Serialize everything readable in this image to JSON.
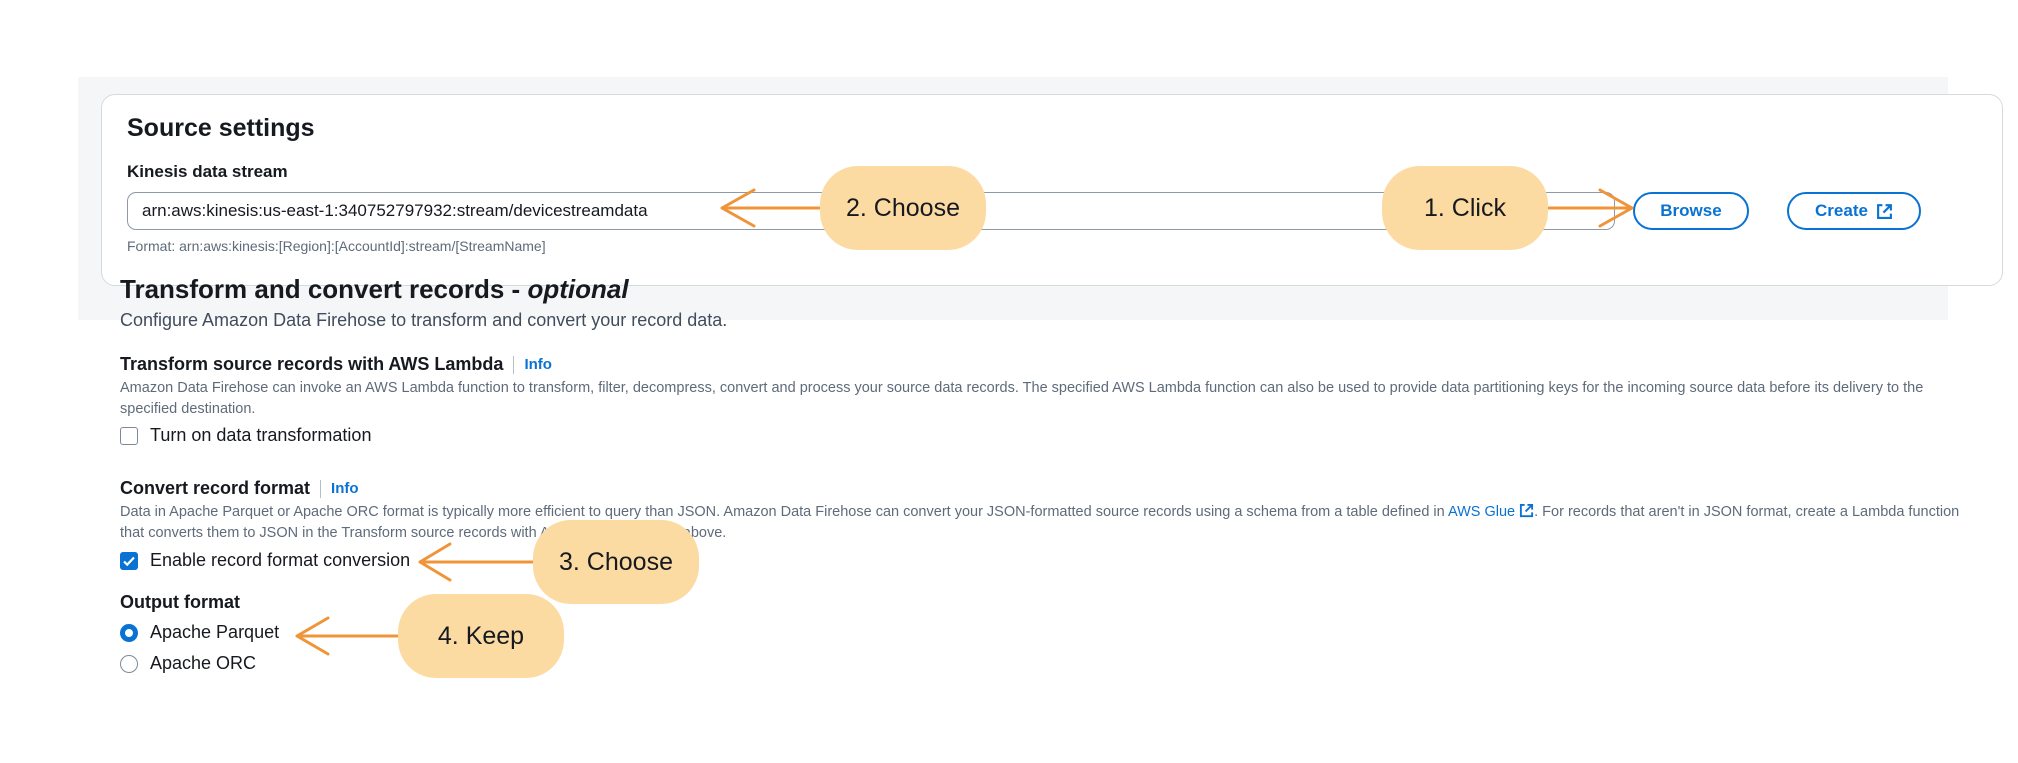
{
  "source_settings": {
    "title": "Source settings",
    "stream_label": "Kinesis data stream",
    "stream_value": "arn:aws:kinesis:us-east-1:340752797932:stream/devicestreamdata",
    "format_hint": "Format: arn:aws:kinesis:[Region]:[AccountId]:stream/[StreamName]",
    "browse_label": "Browse",
    "create_label": "Create"
  },
  "transform": {
    "title": "Transform and convert records - ",
    "title_optional": "optional",
    "description": "Configure Amazon Data Firehose to transform and convert your record data.",
    "lambda_section": {
      "title": "Transform source records with AWS Lambda",
      "info": "Info",
      "description": "Amazon Data Firehose can invoke an AWS Lambda function to transform, filter, decompress, convert and process your source data records. The specified AWS Lambda function can also be used to provide data partitioning keys for the incoming source data before its delivery to the specified destination.",
      "checkbox_label": "Turn on data transformation",
      "checked": false
    },
    "convert_section": {
      "title": "Convert record format",
      "info": "Info",
      "description_part1": "Data in Apache Parquet or Apache ORC format is typically more efficient to query than JSON. Amazon Data Firehose can convert your JSON-formatted source records using a schema from a table defined in ",
      "glue_link": "AWS Glue",
      "description_part2": ". For records that aren't in JSON format, create a Lambda function that converts them to JSON in the Transform source records with AWS Lambda section above.",
      "checkbox_label": "Enable record format conversion",
      "checked": true
    },
    "output_format": {
      "label": "Output format",
      "options": [
        "Apache Parquet",
        "Apache ORC"
      ],
      "selected": "Apache Parquet"
    }
  },
  "callouts": {
    "step1": "1. Click",
    "step2": "2. Choose",
    "step3": "3. Choose",
    "step4": "4. Keep"
  },
  "colors": {
    "accent": "#0972d3",
    "callout_fill": "#fcdba3",
    "arrow": "#f0943a"
  }
}
